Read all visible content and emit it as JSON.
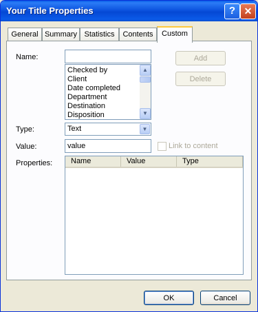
{
  "window": {
    "title": "Your Title Properties"
  },
  "titlebar": {
    "help_glyph": "?",
    "close_glyph": "✕"
  },
  "tabs": [
    {
      "label": "General"
    },
    {
      "label": "Summary"
    },
    {
      "label": "Statistics"
    },
    {
      "label": "Contents"
    },
    {
      "label": "Custom",
      "active": true
    }
  ],
  "custom": {
    "name_label": "Name:",
    "name_value": "",
    "add_button": "Add",
    "delete_button": "Delete",
    "name_options": [
      "Checked by",
      "Client",
      "Date completed",
      "Department",
      "Destination",
      "Disposition"
    ],
    "type_label": "Type:",
    "type_value": "Text",
    "value_label": "Value:",
    "value_value": "value",
    "link_label": "Link to content",
    "properties_label": "Properties:",
    "columns": [
      "Name",
      "Value",
      "Type"
    ]
  },
  "footer": {
    "ok_button": "OK",
    "cancel_button": "Cancel"
  }
}
